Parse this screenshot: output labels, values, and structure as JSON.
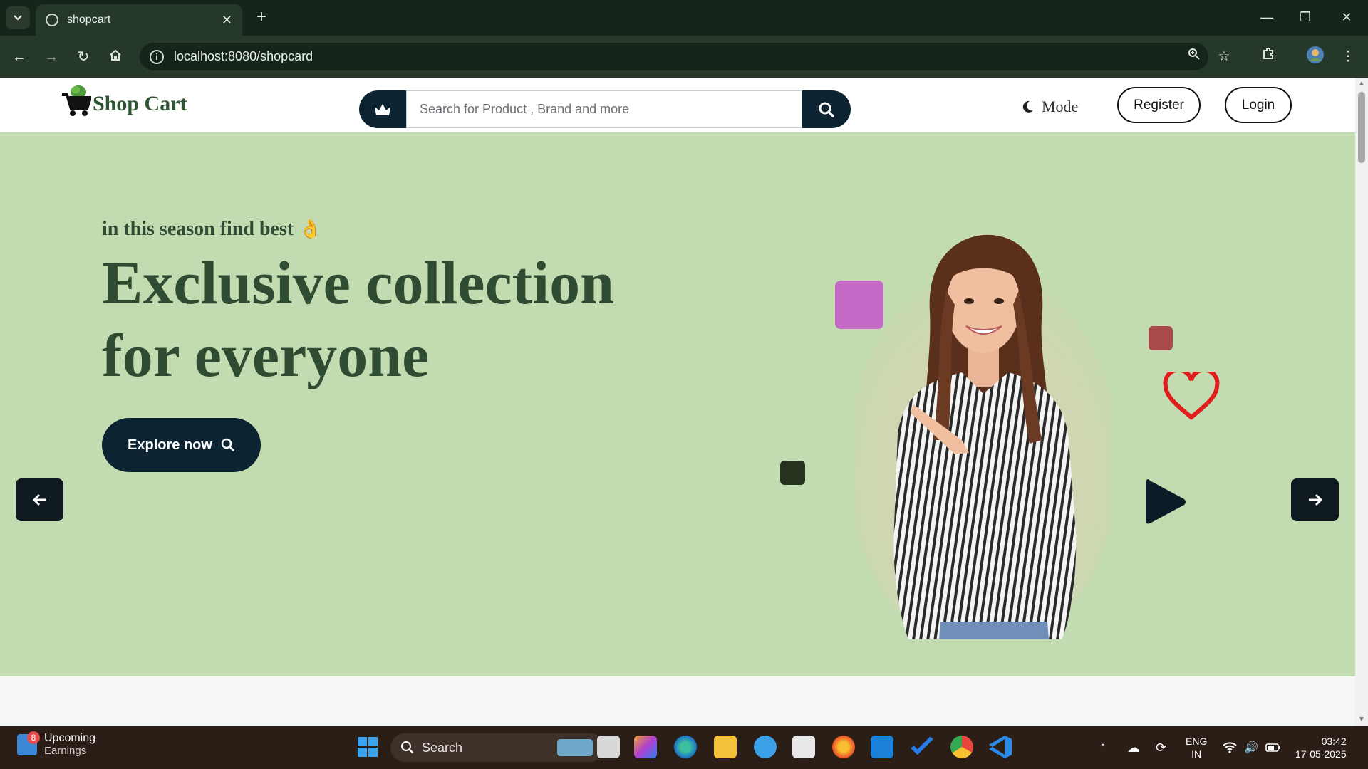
{
  "browser": {
    "tab_title": "shopcart",
    "new_tab_label": "+",
    "close_tab_label": "✕",
    "url": "localhost:8080/shopcard",
    "window_controls": [
      "minimize-icon",
      "restore-icon",
      "close-icon"
    ]
  },
  "header": {
    "logo_text": "Shop Cart",
    "search_placeholder": "Search for Product , Brand and more",
    "mode_label": "Mode",
    "register_label": "Register",
    "login_label": "Login"
  },
  "hero": {
    "kicker": "in this season find best",
    "kicker_emoji": "👌",
    "headline_line1": "Exclusive collection",
    "headline_line2": "for everyone",
    "cta_label": "Explore now"
  },
  "taskbar": {
    "widget_line1": "Upcoming",
    "widget_line2": "Earnings",
    "widget_badge": "8",
    "search_label": "Search",
    "language_line1": "ENG",
    "language_line2": "IN",
    "time": "03:42",
    "date": "17-05-2025"
  },
  "colors": {
    "hero_background": "#c3dbb1",
    "heading_green": "#2f4c33",
    "navy": "#0c2431",
    "heart_red": "#e01e1e"
  }
}
